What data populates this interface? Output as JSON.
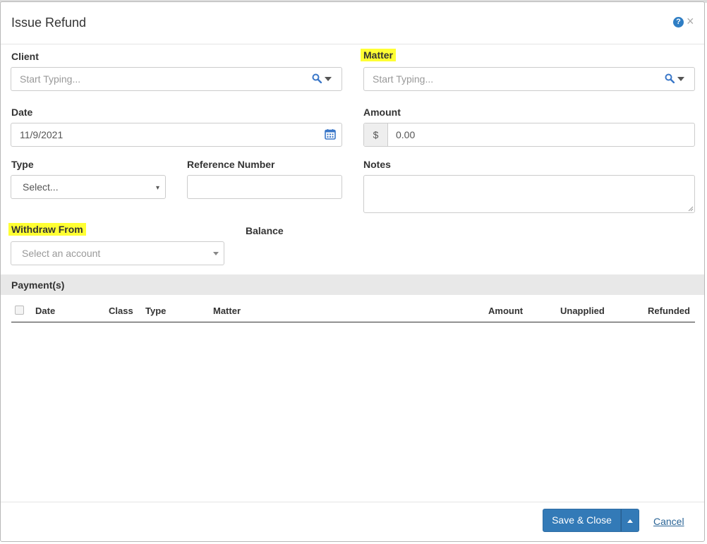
{
  "dialog": {
    "title": "Issue Refund",
    "help_icon": "question-circle-icon",
    "close_icon": "close-icon"
  },
  "form": {
    "client": {
      "label": "Client",
      "placeholder": "Start Typing..."
    },
    "matter": {
      "label": "Matter",
      "placeholder": "Start Typing..."
    },
    "date": {
      "label": "Date",
      "value": "11/9/2021"
    },
    "amount": {
      "label": "Amount",
      "prefix": "$",
      "value": "0.00"
    },
    "type": {
      "label": "Type",
      "selected": "Select..."
    },
    "reference_number": {
      "label": "Reference Number",
      "value": ""
    },
    "notes": {
      "label": "Notes",
      "value": ""
    },
    "withdraw_from": {
      "label": "Withdraw From",
      "placeholder": "Select an account"
    },
    "balance": {
      "label": "Balance"
    }
  },
  "payments": {
    "section_title": "Payment(s)",
    "columns": [
      "Date",
      "Class",
      "Type",
      "Matter",
      "Amount",
      "Unapplied",
      "Refunded"
    ],
    "rows": []
  },
  "footer": {
    "save_label": "Save & Close",
    "cancel_label": "Cancel"
  },
  "colors": {
    "primary": "#337ab7",
    "highlight": "#ffff33",
    "icon_blue": "#2f7ec4"
  }
}
